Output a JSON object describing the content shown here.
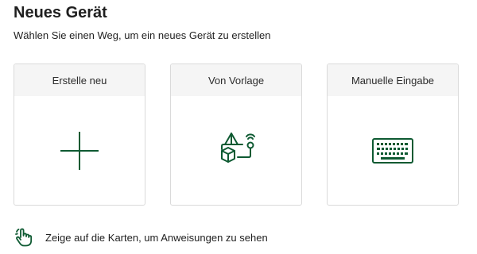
{
  "header": {
    "title": "Neues Gerät",
    "subtitle": "Wählen Sie einen Weg, um ein neues Gerät zu erstellen"
  },
  "cards": [
    {
      "label": "Erstelle neu",
      "icon": "plus-icon"
    },
    {
      "label": "Von Vorlage",
      "icon": "template-flow-icon"
    },
    {
      "label": "Manuelle Eingabe",
      "icon": "keyboard-icon"
    }
  ],
  "hint": {
    "icon": "pointing-hand-icon",
    "text": "Zeige auf die Karten, um Anweisungen zu sehen"
  },
  "colors": {
    "accent": "#0e5a32",
    "card_border": "#dadada",
    "card_header_bg": "#f5f5f5"
  }
}
